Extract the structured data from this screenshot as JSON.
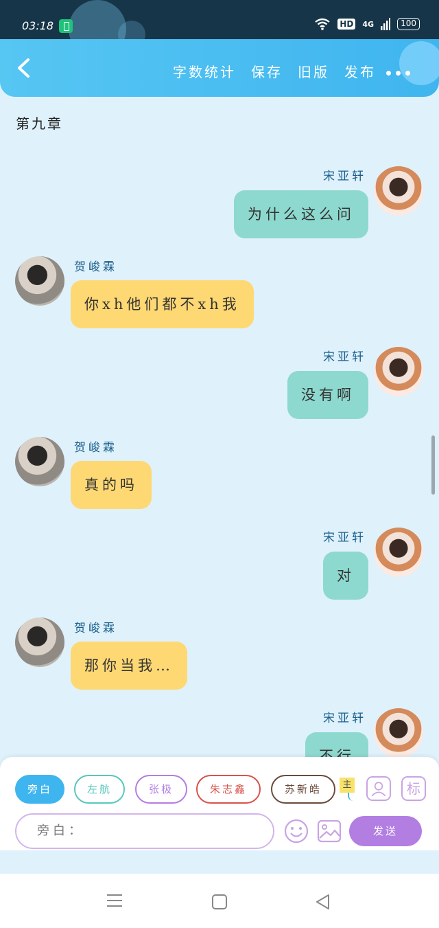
{
  "status_bar": {
    "time": "03:18",
    "hd": "HD",
    "network": "4G",
    "battery": "100"
  },
  "header": {
    "menu": [
      "字数统计",
      "保存",
      "旧版",
      "发布"
    ]
  },
  "chapter_title": "第九章",
  "messages": [
    {
      "side": "right",
      "sender": "宋亚轩",
      "text": "为什么这么问"
    },
    {
      "side": "left",
      "sender": "贺峻霖",
      "text": "你xh他们都不xh我"
    },
    {
      "side": "right",
      "sender": "宋亚轩",
      "text": "没有啊"
    },
    {
      "side": "left",
      "sender": "贺峻霖",
      "text": "真的吗"
    },
    {
      "side": "right",
      "sender": "宋亚轩",
      "text": "对"
    },
    {
      "side": "left",
      "sender": "贺峻霖",
      "text": "那你当我…"
    },
    {
      "side": "right",
      "sender": "宋亚轩",
      "text": "不行"
    }
  ],
  "composer": {
    "roles": [
      {
        "label": "旁白",
        "color": "#3fb5ef"
      },
      {
        "label": "左航",
        "color": "#58c7bd"
      },
      {
        "label": "张极",
        "color": "#b27ee2"
      },
      {
        "label": "朱志鑫",
        "color": "#d9524b"
      },
      {
        "label": "苏新皓",
        "color": "#6b4a3a"
      }
    ],
    "main_tag": "主",
    "mark_label": "标",
    "input_value": "旁白：",
    "send_label": "发送"
  },
  "icons": [
    "back-icon",
    "more-icon",
    "contact-icon",
    "emoji-icon",
    "image-icon"
  ]
}
